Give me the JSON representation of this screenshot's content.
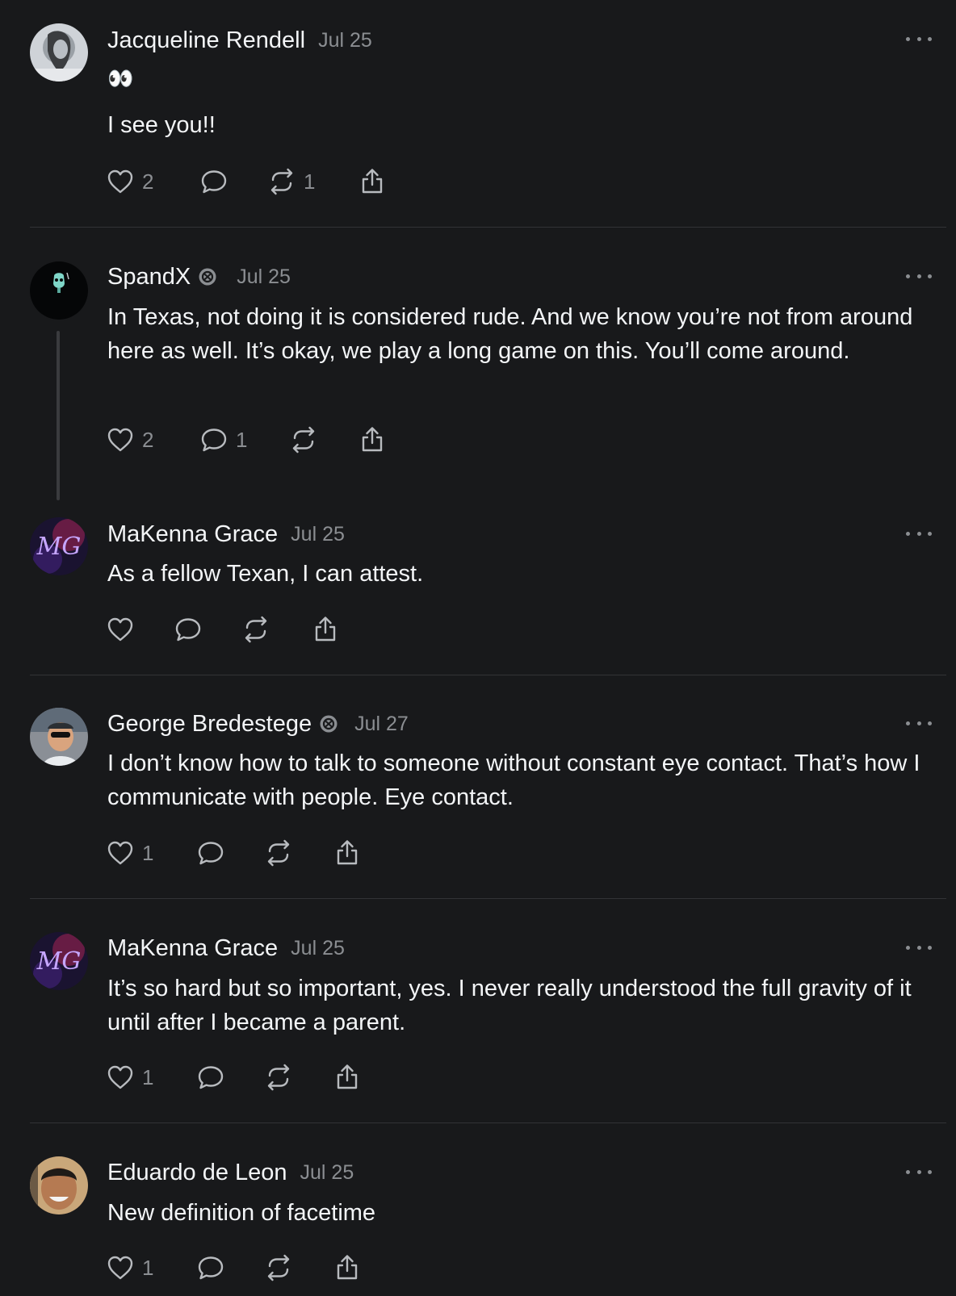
{
  "posts": [
    {
      "author": "Jacqueline Rendell",
      "date": "Jul 25",
      "emoji": "👀",
      "text": "I see you!!",
      "likes": "2",
      "replies": "",
      "reposts": "1"
    },
    {
      "author": "SpandX",
      "date": "Jul 25",
      "verified": true,
      "text": "In Texas, not doing it is considered rude. And we know you’re not from around here as well. It’s okay, we play a long game on this. You’ll come around.",
      "likes": "2",
      "replies": "1",
      "reposts": ""
    },
    {
      "author": "MaKenna Grace",
      "date": "Jul 25",
      "text": "As a fellow Texan, I can attest.",
      "likes": "",
      "replies": "",
      "reposts": ""
    },
    {
      "author": "George Bredestege",
      "date": "Jul 27",
      "verified": true,
      "text": "I don’t know how to talk to someone without constant eye contact. That’s how I communicate with people. Eye contact.",
      "likes": "1",
      "replies": "",
      "reposts": ""
    },
    {
      "author": "MaKenna Grace",
      "date": "Jul 25",
      "text": "It’s so hard but so important, yes. I never really understood the full gravity of it until after I became a parent.",
      "likes": "1",
      "replies": "",
      "reposts": ""
    },
    {
      "author": "Eduardo de Leon",
      "date": "Jul 25",
      "text": "New definition of facetime",
      "likes": "1",
      "replies": "",
      "reposts": ""
    }
  ],
  "icons": {
    "like": "heart-icon",
    "reply": "comment-bubble-icon",
    "repost": "repost-arrows-icon",
    "share": "share-upload-icon",
    "more": "more-dots-icon",
    "verified": "verified-badge-icon"
  },
  "colors": {
    "background": "#18191b",
    "text": "#f3f5f7",
    "muted": "#8b8e92",
    "divider": "#323336"
  }
}
